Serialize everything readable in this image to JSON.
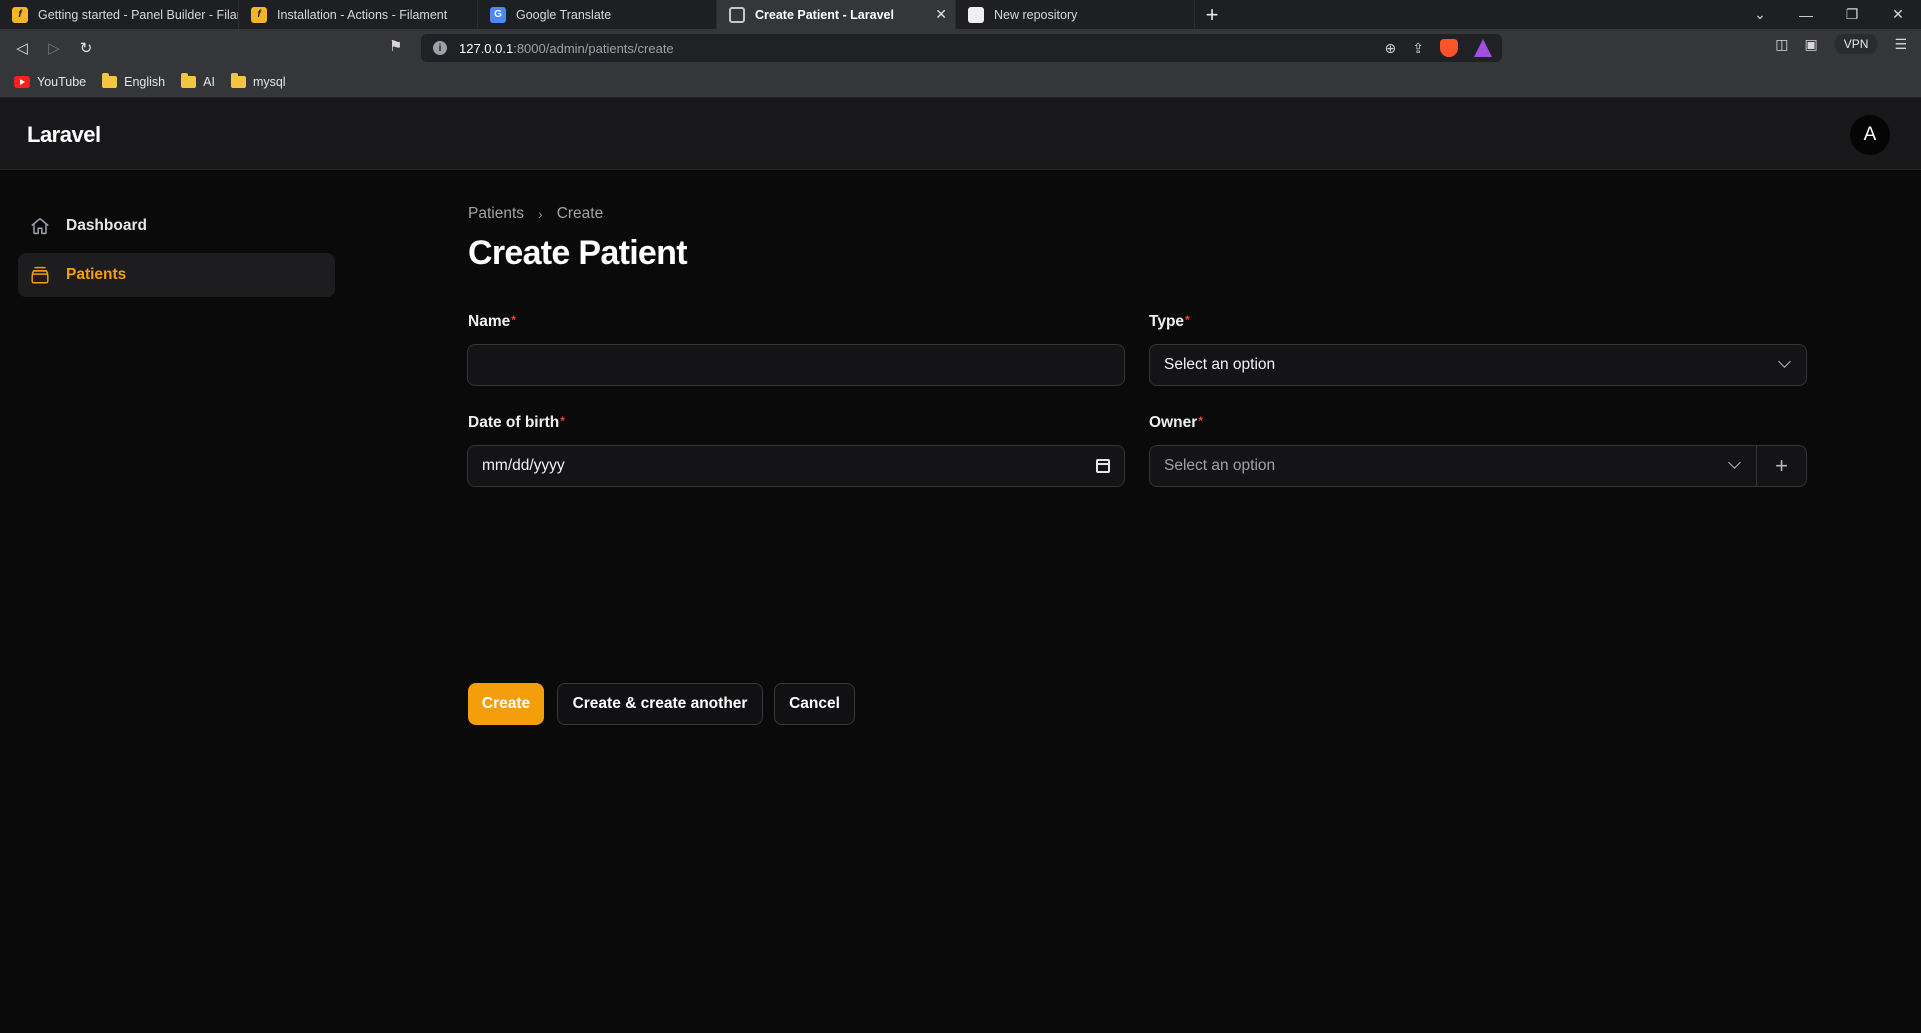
{
  "browser": {
    "tabs": [
      {
        "title": "Getting started - Panel Builder - Filament",
        "icon": "filament-icon",
        "active": false
      },
      {
        "title": "Installation - Actions - Filament",
        "icon": "filament-icon",
        "active": false
      },
      {
        "title": "Google Translate",
        "icon": "google-translate-icon",
        "active": false
      },
      {
        "title": "Create Patient - Laravel",
        "icon": "globe-icon",
        "active": true
      },
      {
        "title": "New repository",
        "icon": "github-icon",
        "active": false
      }
    ],
    "url_host": "127.0.0.1",
    "url_path": ":8000/admin/patients/create",
    "vpn_label": "VPN",
    "bookmarks": [
      {
        "label": "YouTube",
        "icon": "youtube-icon"
      },
      {
        "label": "English",
        "icon": "folder-icon"
      },
      {
        "label": "AI",
        "icon": "folder-icon"
      },
      {
        "label": "mysql",
        "icon": "folder-icon"
      }
    ]
  },
  "app": {
    "brand": "Laravel",
    "avatar_initial": "A",
    "accent_color": "#f59e0b",
    "nav": [
      {
        "label": "Dashboard",
        "icon": "home-icon",
        "active": false
      },
      {
        "label": "Patients",
        "icon": "archive-box-icon",
        "active": true
      }
    ]
  },
  "page": {
    "breadcrumb": [
      "Patients",
      "Create"
    ],
    "title": "Create Patient",
    "fields": {
      "name": {
        "label": "Name",
        "required": "*",
        "value": ""
      },
      "type": {
        "label": "Type",
        "required": "*",
        "value": "Select an option"
      },
      "dob": {
        "label": "Date of birth",
        "required": "*",
        "placeholder": "mm/dd/yyyy"
      },
      "owner": {
        "label": "Owner",
        "required": "*",
        "placeholder": "Select an option"
      }
    },
    "actions": {
      "create": "Create",
      "create_another": "Create & create another",
      "cancel": "Cancel"
    }
  }
}
